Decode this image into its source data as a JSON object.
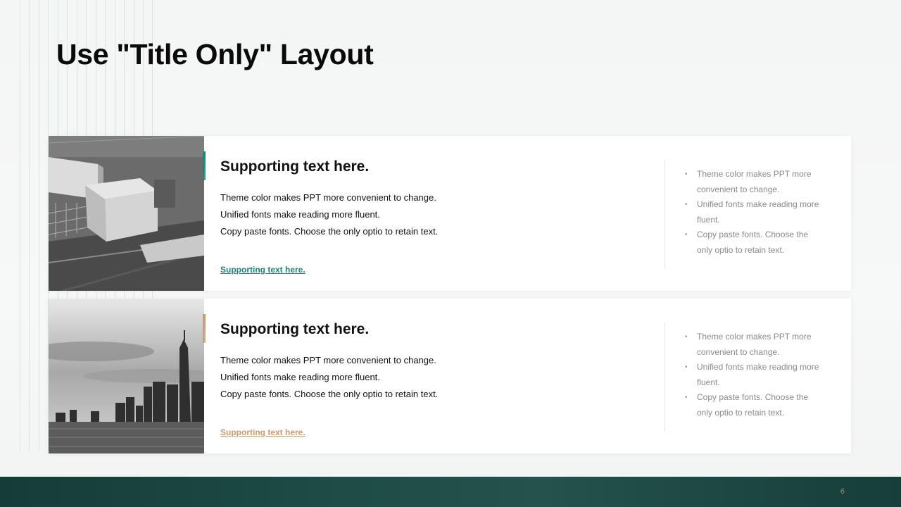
{
  "slide": {
    "title": "Use \"Title Only\" Layout",
    "page_number": "6"
  },
  "colors": {
    "teal": "#1a8578",
    "tan": "#c89b73",
    "footer": "#1e4a44"
  },
  "cards": [
    {
      "image": "cargo-containers-photo",
      "heading": "Supporting text here.",
      "lines": [
        "Theme color makes PPT more convenient to change.",
        "Unified fonts make reading more fluent.",
        "Copy paste fonts. Choose the only optio to retain text."
      ],
      "link": "Supporting text here.",
      "accent": "#1a8578",
      "bullets": [
        "Theme color makes PPT more convenient to change.",
        "Unified fonts make reading more fluent.",
        "Copy paste fonts. Choose the only optio to retain text."
      ]
    },
    {
      "image": "city-skyline-photo",
      "heading": "Supporting text here.",
      "lines": [
        "Theme color makes PPT more convenient to change.",
        "Unified fonts make reading more fluent.",
        "Copy paste fonts. Choose the only optio to retain text."
      ],
      "link": "Supporting text here.",
      "accent": "#c89b73",
      "bullets": [
        "Theme color makes PPT more convenient to change.",
        "Unified fonts make reading more fluent.",
        "Copy paste fonts. Choose the only optio to retain text."
      ]
    }
  ]
}
